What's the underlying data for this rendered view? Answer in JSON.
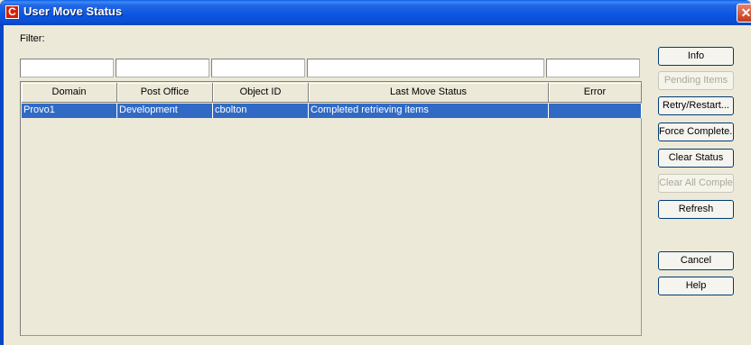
{
  "window": {
    "title": "User Move Status",
    "app_icon": "C",
    "close": "✕"
  },
  "filter": {
    "label": "Filter:",
    "values": [
      "",
      "",
      "",
      "",
      ""
    ]
  },
  "table": {
    "columns": [
      "Domain",
      "Post Office",
      "Object ID",
      "Last Move Status",
      "Error"
    ],
    "rows": [
      [
        "Provo1",
        "Development",
        "cbolton",
        "Completed retrieving items",
        ""
      ]
    ]
  },
  "buttons": {
    "info": "Info",
    "pending_items": "Pending Items",
    "retry_restart": "Retry/Restart...",
    "force_complete": "Force Complete...",
    "clear_status": "Clear Status",
    "clear_all_complete": "Clear All Complete",
    "refresh": "Refresh",
    "cancel": "Cancel",
    "help": "Help"
  },
  "colors": {
    "titlebar": "#0a54e0",
    "selection": "#316ac5",
    "dialog_bg": "#ece9d8"
  }
}
